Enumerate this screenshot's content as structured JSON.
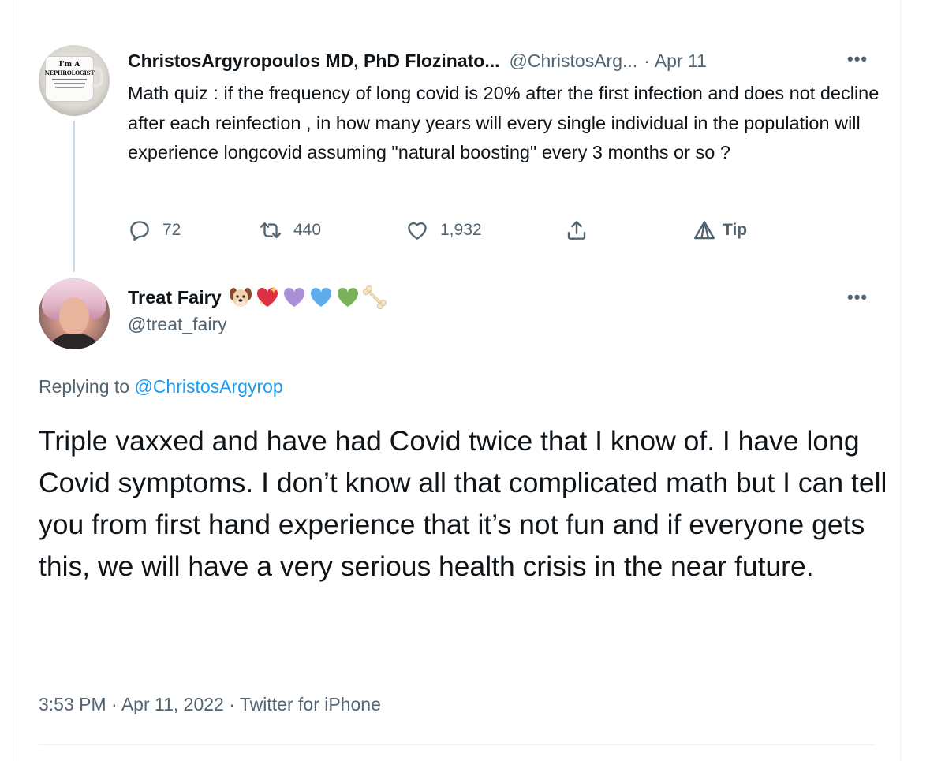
{
  "parent_tweet": {
    "author_name": "ChristosArgyropoulos MD, PhD Flozinato...",
    "author_handle": "@ChristosArg...",
    "separator": "·",
    "date": "Apr 11",
    "more_icon": "more-horizontal-icon",
    "text": "Math quiz : if the frequency of long covid is 20% after the first infection and does not decline after each reinfection , in how many years will every single individual in the population will experience longcovid assuming \"natural boosting\" every 3 months or so ?",
    "avatar_mug_text": [
      "I'm A",
      "NEPHROLOGIST"
    ],
    "actions": {
      "reply_count": "72",
      "retweet_count": "440",
      "like_count": "1,932",
      "tip_label": "Tip"
    }
  },
  "reply_tweet": {
    "author_name": "Treat Fairy",
    "author_emojis": [
      "dog-face-icon",
      "sparkling-heart-icon",
      "purple-heart-icon",
      "blue-heart-icon",
      "green-heart-icon",
      "bone-icon"
    ],
    "author_handle": "@treat_fairy",
    "replying_prefix": "Replying to",
    "replying_to": "@ChristosArgyrop",
    "text": "Triple vaxxed and have had Covid twice that I know of. I have long Covid symptoms. I don’t know all that complicated math but I can tell you from first hand experience that it’s not fun and if everyone gets this, we will have a very serious health crisis in the near future.",
    "time": "3:53 PM",
    "date": "Apr 11, 2022",
    "source": "Twitter for iPhone",
    "separator": "·"
  },
  "colors": {
    "text_primary": "#0f1419",
    "text_secondary": "#536471",
    "link": "#1d9bf0",
    "thread_line": "#cfd9de",
    "border": "#eff3f4"
  }
}
